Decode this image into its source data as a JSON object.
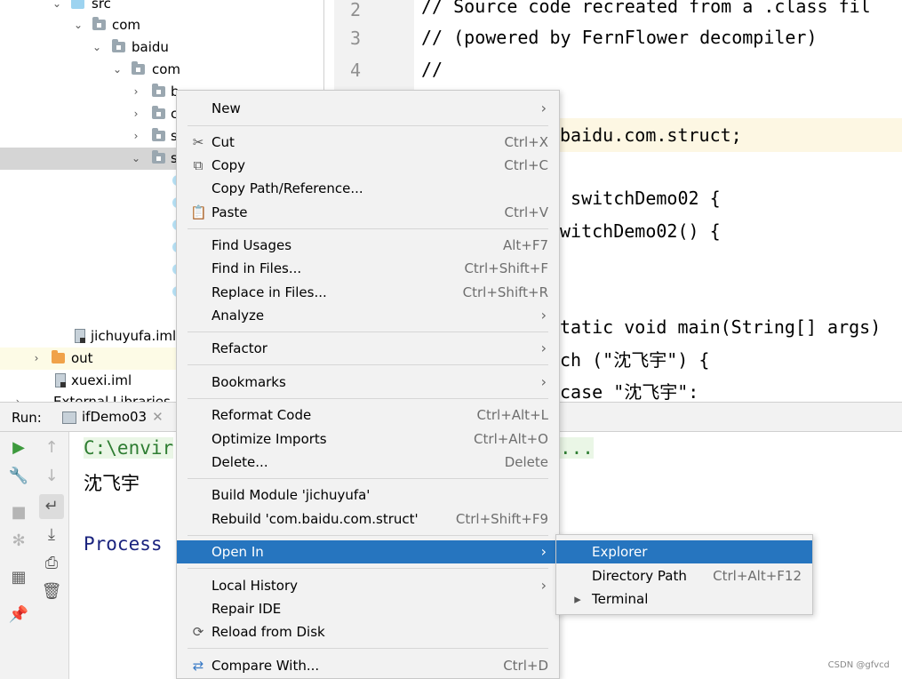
{
  "tree": {
    "rows": [
      {
        "label": "src"
      },
      {
        "label": "com"
      },
      {
        "label": "baidu"
      },
      {
        "label": "com"
      },
      {
        "label": "b"
      },
      {
        "label": "c"
      },
      {
        "label": "s"
      },
      {
        "label": "s"
      },
      {
        "label": "jichuyufa.iml"
      },
      {
        "label": "out"
      },
      {
        "label": "xuexi.iml"
      },
      {
        "label": "External Libraries"
      }
    ]
  },
  "editor": {
    "line_numbers": [
      "2",
      "3",
      "4"
    ],
    "lines": [
      "// Source code recreated from a .class fil",
      "// (powered by FernFlower decompiler)",
      "//",
      "baidu.com.struct;",
      " switchDemo02 {",
      "witchDemo02() {",
      "tatic void main(String[] args)",
      "ch (\"沈飞宇\") {",
      "case \"沈飞宇\":"
    ]
  },
  "run": {
    "title": "Run:",
    "tab_label": "ifDemo03",
    "console": {
      "cmd": "C:\\envir",
      "cmd_tail": "...",
      "output": "沈飞宇",
      "process": "Process"
    }
  },
  "context_menu": {
    "items": {
      "new": {
        "label": "New"
      },
      "cut": {
        "label": "Cut",
        "shortcut": "Ctrl+X"
      },
      "copy": {
        "label": "Copy",
        "shortcut": "Ctrl+C"
      },
      "copy_path": {
        "label": "Copy Path/Reference..."
      },
      "paste": {
        "label": "Paste",
        "shortcut": "Ctrl+V"
      },
      "find_usages": {
        "label": "Find Usages",
        "shortcut": "Alt+F7"
      },
      "find_in_files": {
        "label": "Find in Files...",
        "shortcut": "Ctrl+Shift+F"
      },
      "replace_in_files": {
        "label": "Replace in Files...",
        "shortcut": "Ctrl+Shift+R"
      },
      "analyze": {
        "label": "Analyze"
      },
      "refactor": {
        "label": "Refactor"
      },
      "bookmarks": {
        "label": "Bookmarks"
      },
      "reformat_code": {
        "label": "Reformat Code",
        "shortcut": "Ctrl+Alt+L"
      },
      "optimize_imports": {
        "label": "Optimize Imports",
        "shortcut": "Ctrl+Alt+O"
      },
      "delete": {
        "label": "Delete...",
        "shortcut": "Delete"
      },
      "build_module": {
        "label": "Build Module 'jichuyufa'"
      },
      "rebuild": {
        "label": "Rebuild 'com.baidu.com.struct'",
        "shortcut": "Ctrl+Shift+F9"
      },
      "open_in": {
        "label": "Open In"
      },
      "local_history": {
        "label": "Local History"
      },
      "repair_ide": {
        "label": "Repair IDE"
      },
      "reload_from_disk": {
        "label": "Reload from Disk"
      },
      "compare_with": {
        "label": "Compare With...",
        "shortcut": "Ctrl+D"
      }
    }
  },
  "submenu": {
    "explorer": {
      "label": "Explorer"
    },
    "directory_path": {
      "label": "Directory Path",
      "shortcut": "Ctrl+Alt+F12"
    },
    "terminal": {
      "label": "Terminal"
    }
  },
  "watermark": "CSDN @gfvcd",
  "colors": {
    "selection": "#2675bf",
    "menu_bg": "#f2f2f2",
    "tree_selected": "#d5d5d5",
    "console_process": "#1a237e"
  }
}
